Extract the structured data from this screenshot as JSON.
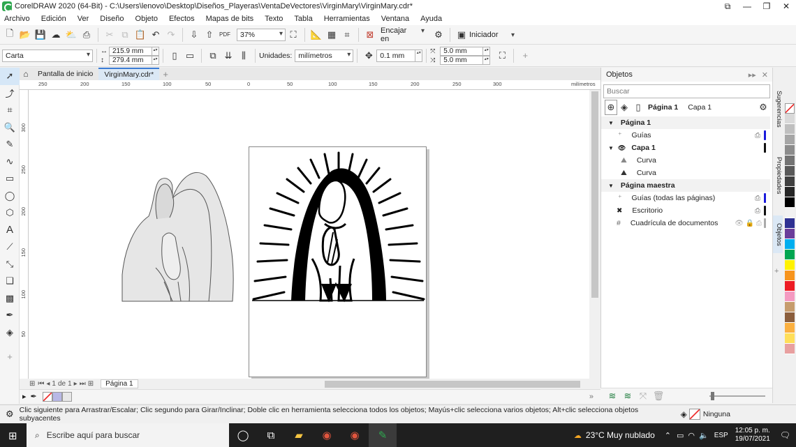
{
  "window": {
    "title": "CorelDRAW 2020 (64-Bit) - C:\\Users\\lenovo\\Desktop\\Diseños_Playeras\\VentaDeVectores\\VirginMary\\VirginMary.cdr*"
  },
  "menu": [
    "Archivo",
    "Edición",
    "Ver",
    "Diseño",
    "Objeto",
    "Efectos",
    "Mapas de bits",
    "Texto",
    "Tabla",
    "Herramientas",
    "Ventana",
    "Ayuda"
  ],
  "toolbar1": {
    "zoom": "37%",
    "snap_label": "Encajar en",
    "workspace_label": "Iniciador"
  },
  "toolbar2": {
    "paper": "Carta",
    "width": "215.9 mm",
    "height": "279.4 mm",
    "units_label": "Unidades:",
    "units_value": "milímetros",
    "nudge": "0.1 mm",
    "dup_x": "5.0 mm",
    "dup_y": "5.0 mm"
  },
  "tabs": {
    "home": "Pantalla de inicio",
    "doc": "VirginMary.cdr*"
  },
  "ruler": {
    "h_labels": [
      "250",
      "200",
      "150",
      "100",
      "50",
      "0",
      "50",
      "100",
      "150",
      "200",
      "250",
      "300"
    ],
    "unit": "milímetros",
    "v_labels": [
      "300",
      "250",
      "200",
      "150",
      "100",
      "50"
    ]
  },
  "page_nav": {
    "current": "1",
    "of_label": "de",
    "total": "1",
    "page_tab": "Página 1"
  },
  "docker": {
    "title": "Objetos",
    "search_placeholder": "Buscar",
    "crumb_page": "Página 1",
    "crumb_layer": "Capa 1",
    "tree": {
      "page1": "Página 1",
      "guides": "Guías",
      "layer1": "Capa 1",
      "curve1": "Curva",
      "curve2": "Curva",
      "master": "Página maestra",
      "guides_all": "Guías (todas las páginas)",
      "desktop": "Escritorio",
      "grid": "Cuadrícula de documentos"
    }
  },
  "side_tabs": [
    "Sugerencias",
    "Propiedades",
    "Objetos"
  ],
  "palette_colors": [
    "#ffffff",
    "#d9d9d9",
    "#bfbfbf",
    "#a6a6a6",
    "#8c8c8c",
    "#737373",
    "#595959",
    "#404040",
    "#262626",
    "#000000",
    "#f2f2f2",
    "#2e3192",
    "#6a3d9a",
    "#00aeef",
    "#00a651",
    "#fff200",
    "#f7941d",
    "#ed1c24",
    "#f49ac1",
    "#c69c6d",
    "#8b5e3c",
    "#fbb040",
    "#ffde59",
    "#e8a0a0"
  ],
  "status": {
    "hint": "Clic siguiente para Arrastrar/Escalar; Clic segundo para Girar/Inclinar; Doble clic en herramienta selecciona todos los objetos; Mayús+clic selecciona varios objetos; Alt+clic selecciona objetos subyacentes",
    "fill_label": "Ninguna"
  },
  "taskbar": {
    "search_placeholder": "Escribe aquí para buscar",
    "weather": "23°C  Muy nublado",
    "lang": "ESP",
    "time": "12:05 p. m.",
    "date": "19/07/2021"
  }
}
